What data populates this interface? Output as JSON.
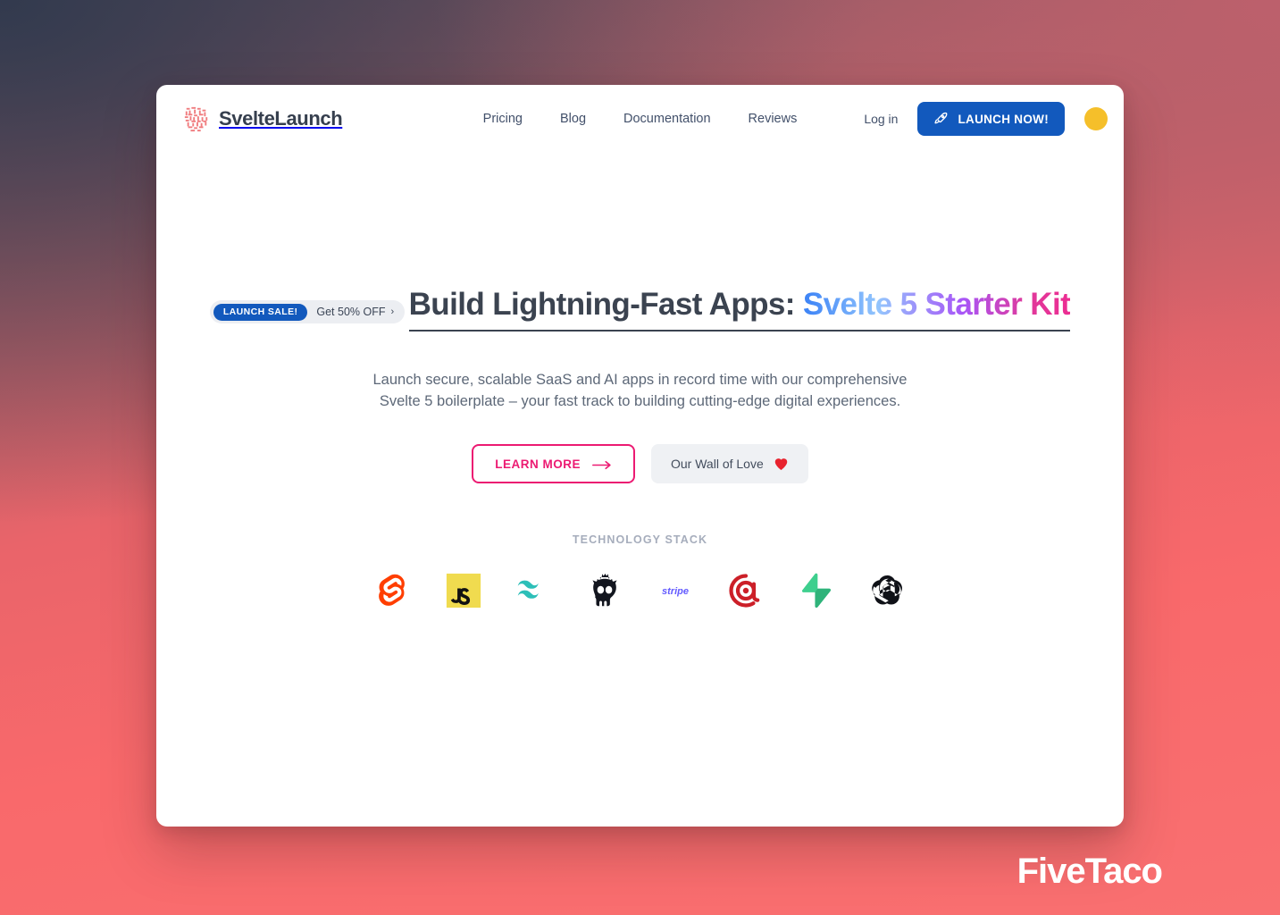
{
  "brand": {
    "name": "SvelteLaunch",
    "logo_icon": "maze-pattern-icon",
    "logo_color": "#f07b7e"
  },
  "header": {
    "nav": [
      {
        "label": "Pricing"
      },
      {
        "label": "Blog"
      },
      {
        "label": "Documentation"
      },
      {
        "label": "Reviews"
      }
    ],
    "login_label": "Log in",
    "launch_label": "LAUNCH NOW!",
    "launch_icon": "rocket-icon",
    "launch_color": "#1259bd",
    "avatar_icon": "avatar-circle-icon",
    "avatar_color": "#f5bf2a"
  },
  "hero": {
    "sale_badge": "LAUNCH SALE!",
    "sale_text": "Get 50% OFF",
    "sale_chevron": "›",
    "headline_plain": "Build Lightning-Fast Apps: ",
    "headline_gradient": "Svelte 5 Starter Kit",
    "subhead": "Launch secure, scalable SaaS and AI apps in record time with our comprehensive Svelte 5 boilerplate – your fast track to building cutting-edge digital experiences.",
    "cta_primary": "LEARN MORE",
    "cta_primary_icon": "arrow-right-icon",
    "cta_secondary": "Our Wall of Love",
    "cta_secondary_icon": "heart-icon",
    "gradient_colors": [
      "#3b82f6",
      "#93c5fd",
      "#a855f7",
      "#ec2d92"
    ],
    "accent_pink": "#ec1a72"
  },
  "stack": {
    "label": "TECHNOLOGY STACK",
    "logos": [
      {
        "name": "svelte-logo-icon",
        "color": "#ff3e00"
      },
      {
        "name": "javascript-logo-icon",
        "color": "#f0db4f"
      },
      {
        "name": "tailwindcss-logo-icon",
        "color": "#2dbfb8"
      },
      {
        "name": "skeleton-ui-logo-icon",
        "color": "#13161f"
      },
      {
        "name": "stripe-logo-icon",
        "color": "#635bff"
      },
      {
        "name": "resend-at-logo-icon",
        "color": "#cc1f28"
      },
      {
        "name": "supabase-logo-icon",
        "color": "#3ecf8e"
      },
      {
        "name": "openai-logo-icon",
        "color": "#0f1117"
      }
    ]
  },
  "watermark": {
    "text": "FiveTaco"
  }
}
